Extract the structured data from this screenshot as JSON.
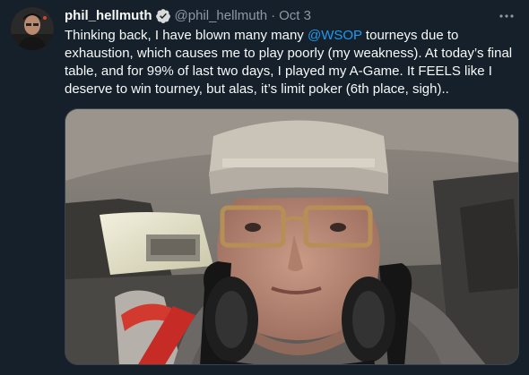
{
  "tweet": {
    "display_name": "phil_hellmuth",
    "handle": "@phil_hellmuth",
    "separator": "·",
    "date": "Oct 3",
    "more_icon": "more-horizontal-icon",
    "verified_icon": "verified-badge-icon",
    "text_part1": "Thinking back, I have blown many many ",
    "mention": "@WSOP",
    "text_part2": " tourneys due to exhaustion, which causes me to play poorly (my weakness). At today’s final table, and for 99% of last two days, I played my A-Game. It FEELS like I deserve to win tourney, but alas, it’s limit poker (6th place, sigh)..",
    "colors": {
      "background": "#15202b",
      "text": "#f7f9f9",
      "secondary": "#8b98a5",
      "link": "#1d9bf0"
    }
  }
}
